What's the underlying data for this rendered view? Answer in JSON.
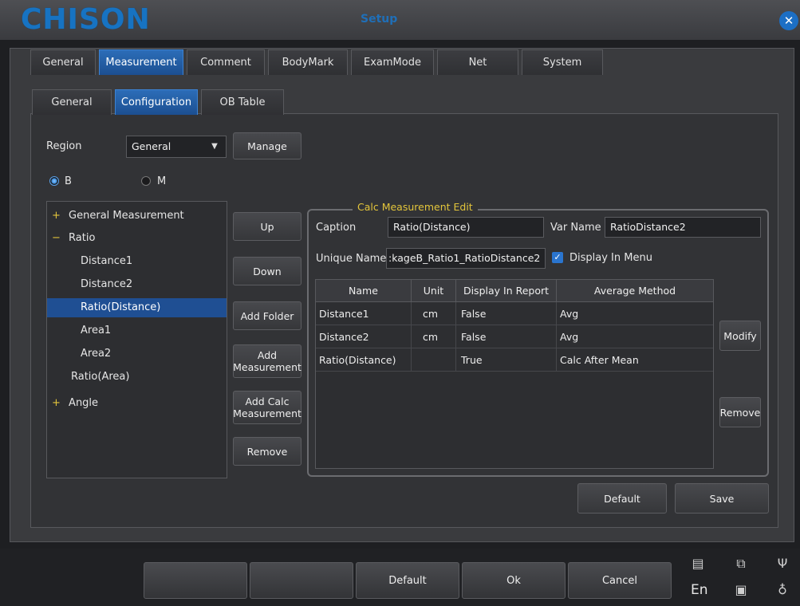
{
  "window": {
    "logo": "CHISON",
    "title": "Setup",
    "close_icon": "close-icon"
  },
  "main_tabs": [
    {
      "label": "General"
    },
    {
      "label": "Measurement"
    },
    {
      "label": "Comment"
    },
    {
      "label": "BodyMark"
    },
    {
      "label": "ExamMode"
    },
    {
      "label": "Net"
    },
    {
      "label": "System"
    }
  ],
  "sub_tabs": [
    {
      "label": "General"
    },
    {
      "label": "Configuration"
    },
    {
      "label": "OB Table"
    }
  ],
  "region": {
    "label": "Region",
    "value": "General",
    "manage_button": "Manage"
  },
  "mode": {
    "b_label": "B",
    "m_label": "M",
    "selected": "B"
  },
  "tree": [
    {
      "prefix": "+",
      "label": "General Measurement"
    },
    {
      "prefix": "−",
      "label": "Ratio"
    },
    {
      "label": "Distance1"
    },
    {
      "label": "Distance2"
    },
    {
      "label": "Ratio(Distance)",
      "selected": true
    },
    {
      "label": "Area1"
    },
    {
      "label": "Area2"
    },
    {
      "label": "Ratio(Area)"
    },
    {
      "prefix": "+",
      "label": "Angle"
    }
  ],
  "middle_buttons": {
    "up": "Up",
    "down": "Down",
    "add_folder": "Add Folder",
    "add_measurement_1": "Add",
    "add_measurement_2": "Measurement",
    "add_calc_1": "Add Calc",
    "add_calc_2": "Measurement",
    "remove": "Remove"
  },
  "calc_edit": {
    "title": "Calc Measurement Edit",
    "caption_label": "Caption",
    "caption_value": "Ratio(Distance)",
    "varname_label": "Var Name",
    "varname_value": "RatioDistance2",
    "unique_label": "Unique Name",
    "unique_value": ":kageB_Ratio1_RatioDistance2",
    "display_in_menu_label": "Display In Menu",
    "display_in_menu_checked": true,
    "columns": [
      "Name",
      "Unit",
      "Display In Report",
      "Average Method"
    ],
    "rows": [
      [
        "Distance1",
        "cm",
        "False",
        "Avg"
      ],
      [
        "Distance2",
        "cm",
        "False",
        "Avg"
      ],
      [
        "Ratio(Distance)",
        "",
        "True",
        "Calc After Mean"
      ]
    ],
    "modify_button": "Modify",
    "remove_button": "Remove"
  },
  "footer_buttons": {
    "default": "Default",
    "save": "Save"
  },
  "bottom_bar": {
    "default": "Default",
    "ok": "Ok",
    "cancel": "Cancel",
    "lang": "En"
  },
  "colors": {
    "accent": "#1f5fae",
    "group_title": "#e3c53b",
    "logo": "#1773c2"
  }
}
